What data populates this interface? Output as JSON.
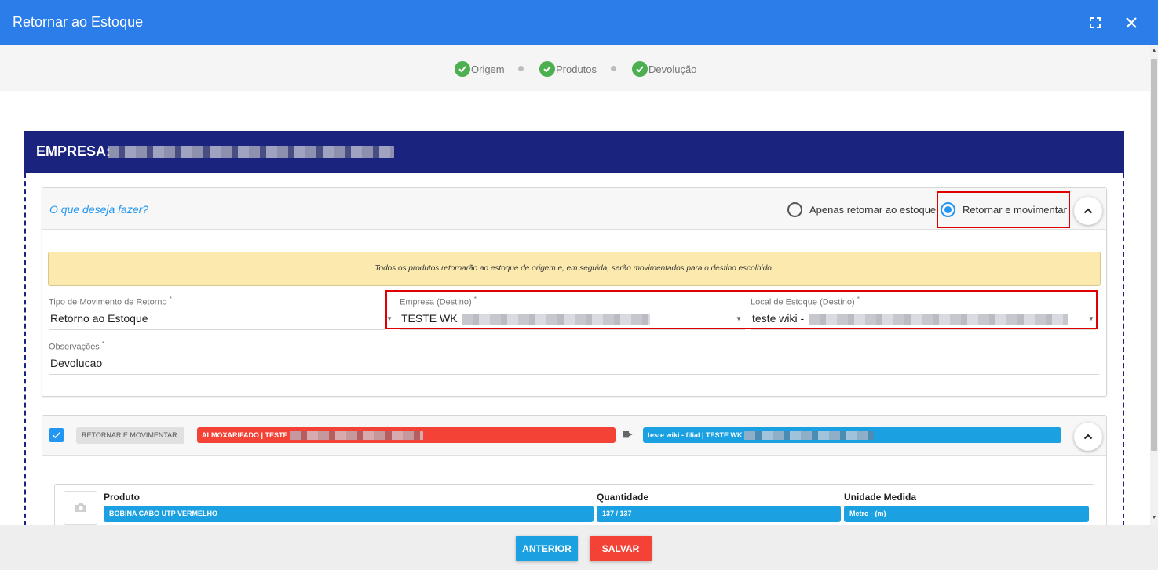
{
  "window": {
    "title": "Retornar ao Estoque",
    "icons": [
      "fullscreen-icon",
      "close-icon"
    ]
  },
  "stepper": {
    "steps": [
      {
        "label": "Origem",
        "status": "done"
      },
      {
        "label": "Produtos",
        "status": "done"
      },
      {
        "label": "Devolução",
        "status": "done"
      }
    ]
  },
  "empresa": {
    "label": "EMPRESA:"
  },
  "action_card": {
    "question": "O que deseja fazer?",
    "options": [
      {
        "label": "Apenas retornar ao estoque",
        "selected": false
      },
      {
        "label": "Retornar e movimentar",
        "selected": true
      }
    ],
    "notice": "Todos os produtos retornarão ao estoque de origem e, em seguida, serão movimentados para o destino escolhido.",
    "fields": {
      "tipo_movimento": {
        "label": "Tipo de Movimento de Retorno",
        "required": "*",
        "value": "Retorno ao Estoque"
      },
      "empresa_destino": {
        "label": "Empresa (Destino)",
        "required": "*",
        "value": "TESTE WK"
      },
      "local_estoque": {
        "label": "Local de Estoque (Destino)",
        "required": "*",
        "value": "teste wiki -"
      },
      "observacoes": {
        "label": "Observações",
        "required": "*",
        "value": "Devolucao"
      }
    }
  },
  "move_card": {
    "checked": true,
    "chip": "RETORNAR E MOVIMENTAR:",
    "origin": "ALMOXARIFADO | TESTE",
    "destination": "teste wiki - filial | TESTE WK",
    "table": {
      "headers": [
        "Produto",
        "Quantidade",
        "Unidade Medida"
      ],
      "row": [
        "BOBINA CABO UTP VERMELHO",
        "137 / 137",
        "Metro - (m)"
      ]
    }
  },
  "footer": {
    "prev_label": "ANTERIOR",
    "save_label": "SALVAR"
  },
  "colors": {
    "header_blue": "#2b7de9",
    "empresa_navy": "#1a237e",
    "check_green": "#4caf50",
    "accent_blue": "#2196f3",
    "origin_red": "#f44336",
    "highlight_red": "#e00000",
    "notice_yellow": "#fbe9ad"
  }
}
